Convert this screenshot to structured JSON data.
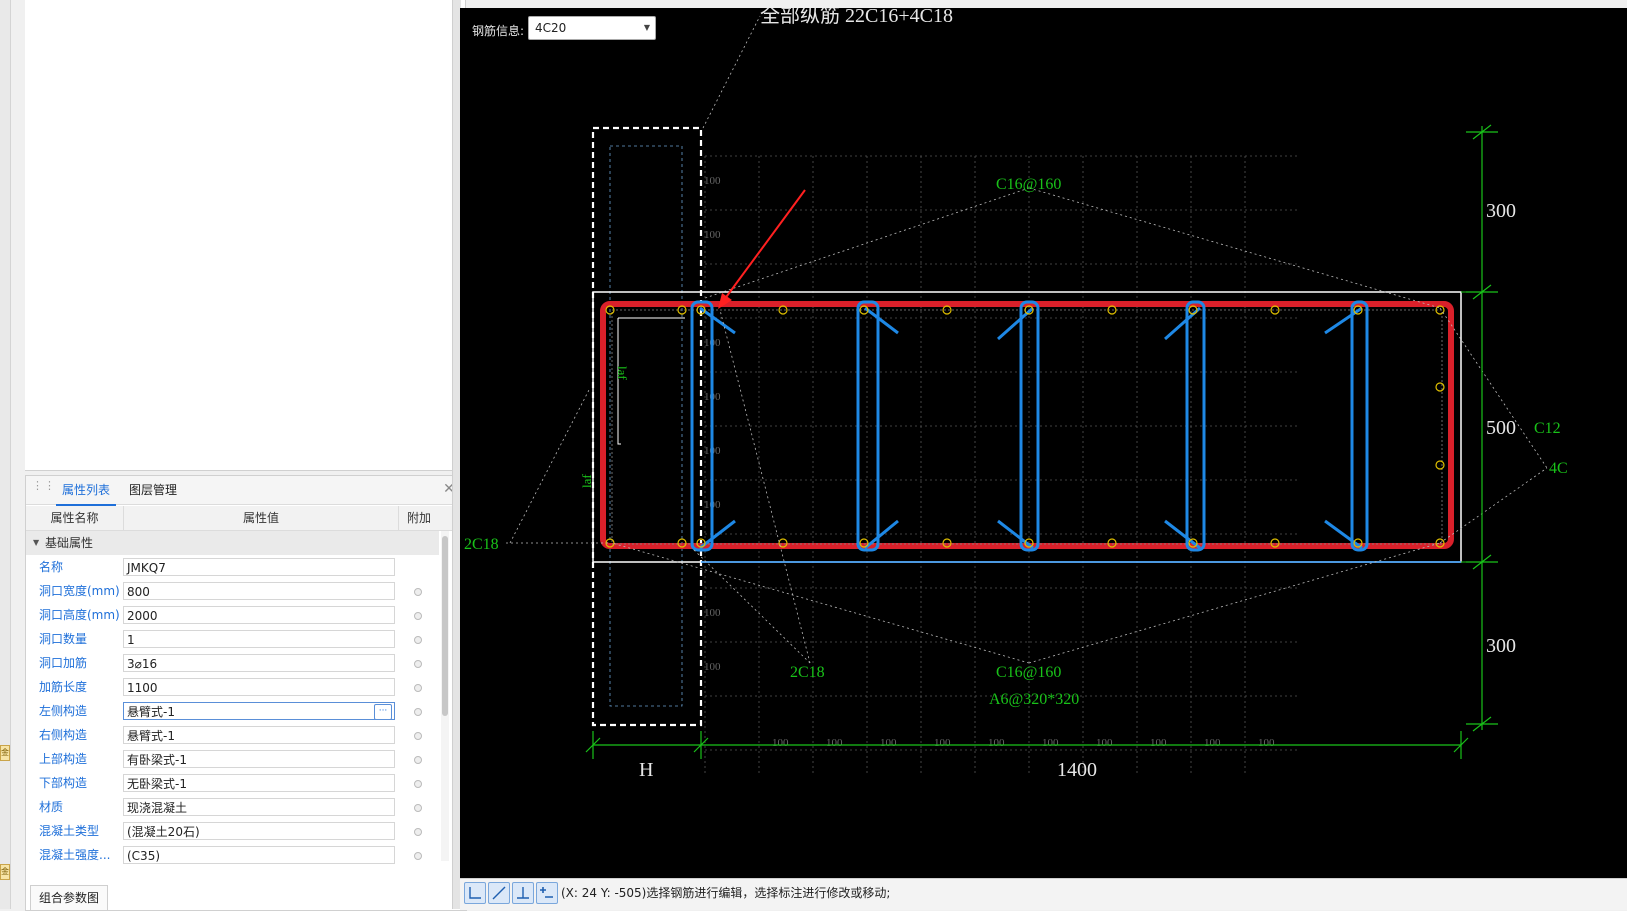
{
  "left_panel": {
    "tabs": {
      "properties": "属性列表",
      "layers": "图层管理"
    },
    "header": {
      "name": "属性名称",
      "value": "属性值",
      "extra": "附加"
    },
    "group": "基础属性",
    "rows": [
      {
        "name": "名称",
        "value": "JMKQ7",
        "has_radio": false
      },
      {
        "name": "洞口宽度(mm)",
        "value": "800",
        "has_radio": true
      },
      {
        "name": "洞口高度(mm)",
        "value": "2000",
        "has_radio": true
      },
      {
        "name": "洞口数量",
        "value": "1",
        "has_radio": true
      },
      {
        "name": "洞口加筋",
        "value": "3⌀16",
        "has_radio": true
      },
      {
        "name": "加筋长度",
        "value": "1100",
        "has_radio": true
      },
      {
        "name": "左侧构造",
        "value": "悬臂式-1",
        "has_radio": true,
        "active": true
      },
      {
        "name": "右侧构造",
        "value": "悬臂式-1",
        "has_radio": true
      },
      {
        "name": "上部构造",
        "value": "有卧梁式-1",
        "has_radio": true
      },
      {
        "name": "下部构造",
        "value": "无卧梁式-1",
        "has_radio": true
      },
      {
        "name": "材质",
        "value": "现浇混凝土",
        "has_radio": true
      },
      {
        "name": "混凝土类型",
        "value": "(混凝土20石)",
        "has_radio": true
      },
      {
        "name": "混凝土强度...",
        "value": "(C35)",
        "has_radio": true
      }
    ],
    "bottom_tab": "组合参数图",
    "strip_marks": [
      "金",
      "金"
    ]
  },
  "canvas": {
    "rebar_info_label": "钢筋信息:",
    "rebar_select_value": "4C20",
    "labels": {
      "all_long": "全部纵筋  22C16+4C18",
      "stirrup_top": "C16@160",
      "stirrup_bottom": "C16@160",
      "tie": "A6@320*320",
      "left_2c18": "2C18",
      "bottom_2c18": "2C18",
      "dim_300_top": "300",
      "dim_500": "500",
      "dim_300_bottom": "300",
      "dim_h": "H",
      "dim_1400": "1400",
      "right_c12": "C12",
      "right_4c": "4C",
      "laf_v": "laf",
      "laf_h": "laf"
    },
    "grid_label": "100",
    "colors": {
      "background": "#000000",
      "beam_outline": "#d9202a",
      "stirrup": "#1e88e5",
      "dimension": "#19c219",
      "annotation": "#19c219",
      "frame": "#ffffff",
      "rebar_point": "#e0c000",
      "arrow": "#ff2020"
    }
  },
  "status": {
    "tool_icons": [
      "corner-dim-icon",
      "aligned-dim-icon",
      "perpendicular-dim-icon",
      "add-dim-icon"
    ],
    "text": "(X: 24 Y: -505)选择钢筋进行编辑，选择标注进行修改或移动;"
  }
}
